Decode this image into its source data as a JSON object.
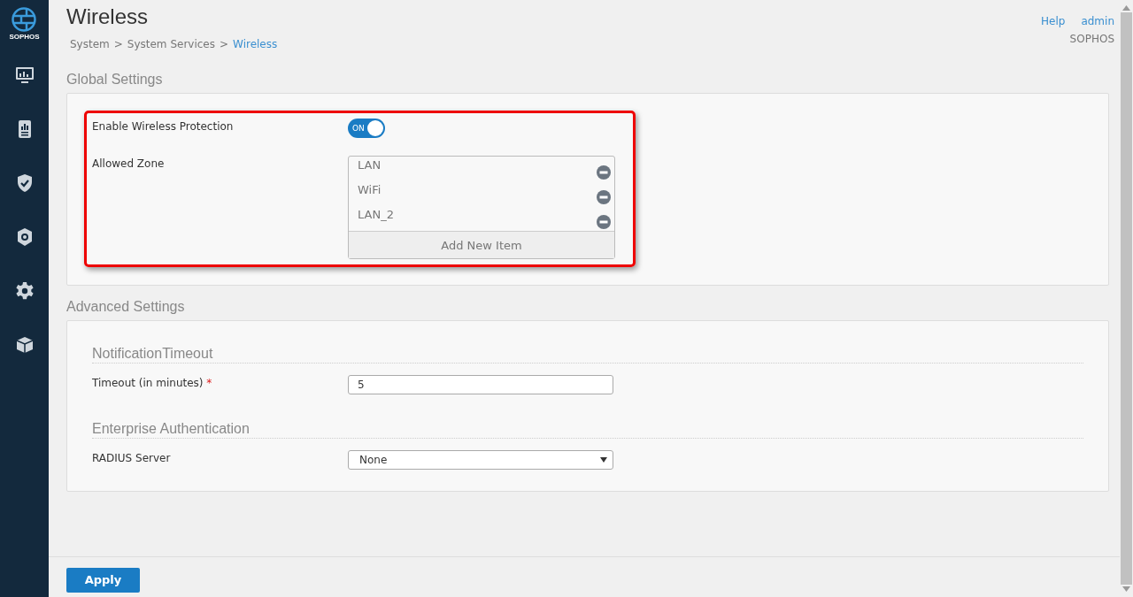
{
  "sidebar": {
    "logo_text": "SOPHOS",
    "items": [
      {
        "kind": "monitor",
        "selected": false
      },
      {
        "kind": "report",
        "selected": false
      },
      {
        "kind": "shield",
        "selected": false
      },
      {
        "kind": "shield-gear",
        "selected": false
      },
      {
        "kind": "gear",
        "selected": false
      },
      {
        "kind": "box",
        "selected": false
      }
    ]
  },
  "header": {
    "title": "Wireless",
    "breadcrumb": [
      {
        "label": "System",
        "current": false
      },
      {
        "label": "System Services",
        "current": false
      },
      {
        "label": "Wireless",
        "current": true
      }
    ],
    "breadcrumb_separator": ">",
    "links": [
      "Help",
      "admin"
    ],
    "account": "SOPHOS"
  },
  "global_settings": {
    "title": "Global Settings",
    "highlighted": true,
    "protection": {
      "label": "Enable Wireless Protection",
      "toggle_text": "ON",
      "on": true
    },
    "zones": {
      "label": "Allowed Zone",
      "items": [
        "LAN",
        "WiFi",
        "LAN_2"
      ],
      "add_label": "Add New Item"
    }
  },
  "advanced_settings": {
    "title": "Advanced Settings",
    "sections": [
      {
        "title": "NotificationTimeout",
        "kind": "input",
        "label": "Timeout (in minutes)",
        "required_mark": "*",
        "value": "5"
      },
      {
        "title": "Enterprise Authentication",
        "kind": "select",
        "label": "RADIUS Server",
        "value": "None"
      }
    ]
  },
  "footer": {
    "apply_label": "Apply"
  }
}
